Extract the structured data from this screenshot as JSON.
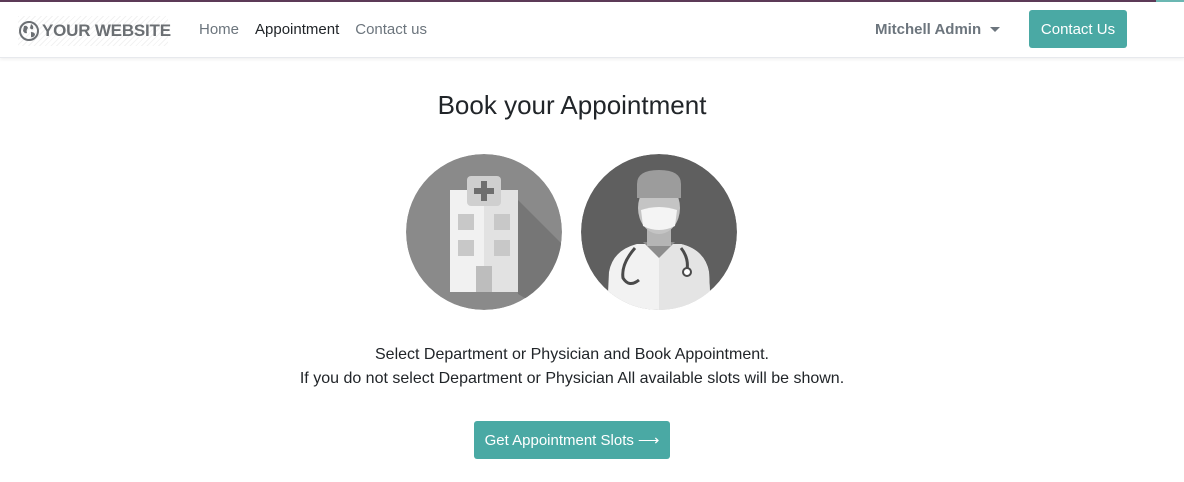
{
  "brand": {
    "name": "YOUR WEBSITE",
    "icon": "globe-icon"
  },
  "nav": {
    "items": [
      {
        "label": "Home",
        "active": false
      },
      {
        "label": "Appointment",
        "active": true
      },
      {
        "label": "Contact us",
        "active": false
      }
    ]
  },
  "user": {
    "name": "Mitchell Admin",
    "icon": "caret-down-icon"
  },
  "header": {
    "contact_button": "Contact Us"
  },
  "main": {
    "title": "Book your Appointment",
    "options": [
      {
        "kind": "department",
        "icon": "hospital-icon"
      },
      {
        "kind": "physician",
        "icon": "doctor-icon"
      }
    ],
    "description_line1": "Select Department or Physician and Book Appointment.",
    "description_line2": "If you do not select Department or Physician All available slots will be shown.",
    "slots_button": "Get Appointment Slots",
    "slots_button_icon": "arrow-right-icon"
  },
  "colors": {
    "primary": "#4aa9a4",
    "top_bar": "#5c3a57",
    "nav_text": "#6c757d",
    "nav_active": "#212529"
  }
}
